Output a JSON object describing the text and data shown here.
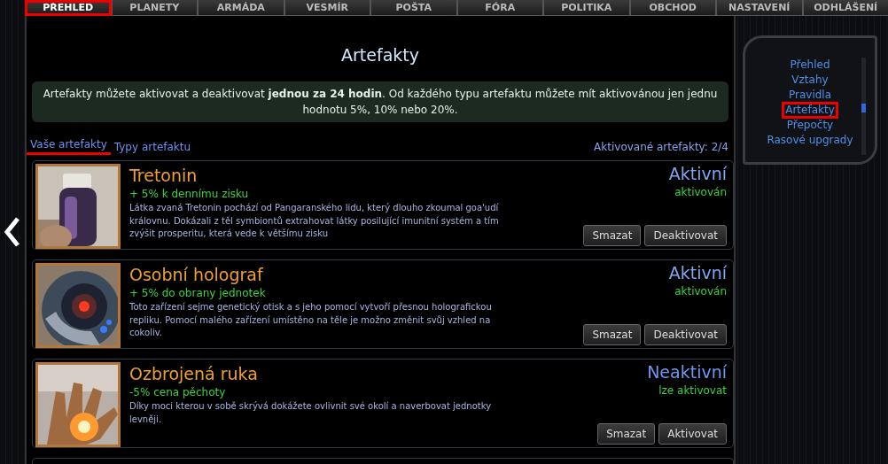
{
  "nav_tabs": [
    {
      "label": "PŘEHLED",
      "selected": true
    },
    {
      "label": "PLANETY",
      "selected": false
    },
    {
      "label": "ARMÁDA",
      "selected": false
    },
    {
      "label": "VESMÍR",
      "selected": false
    },
    {
      "label": "POŠTA",
      "selected": false
    },
    {
      "label": "FÓRA",
      "selected": false
    },
    {
      "label": "POLITIKA",
      "selected": false
    },
    {
      "label": "OBCHOD",
      "selected": false
    },
    {
      "label": "NASTAVENÍ",
      "selected": false
    },
    {
      "label": "ODHLÁŠENÍ",
      "selected": false
    }
  ],
  "page_title": "Artefakty",
  "info": "Artefakty můžete aktivovat a deaktivovat **jednou za 24 hodin**. Od každého typu artefaktu můžete mít aktivovánou jen jednu hodnotu 5%, 10% nebo 20%.",
  "sub_tabs": [
    {
      "label": "Vaše artefakty",
      "selected": true
    },
    {
      "label": "Typy artefaktu",
      "selected": false
    }
  ],
  "active_count": "Aktivované artefakty: 2/4",
  "artifacts": [
    {
      "name": "Tretonin",
      "bonus": "+ 5% k dennímu zisku",
      "description": "Látka zvaná Tretonin pochází od Pangaranského lidu, který dlouho zkoumal goa'udí královnu. Dokázali z těl symbiontů extrahovat látky posilující imunitní systém a tím zvýšit prosperitu, která vede k většímu zisku",
      "status": "Aktivní",
      "substatus": "aktivován",
      "active": true,
      "buttons": [
        "Smazat",
        "Deaktivovat"
      ]
    },
    {
      "name": "Osobní holograf",
      "bonus": "+ 5% do obrany jednotek",
      "description": "Toto zařízení sejme genetický otisk a s jeho pomocí vytvoří přesnou holografickou repliku. Pomocí malého zařízení umístěno na těle je možno změnit svůj vzhled na cokoliv.",
      "status": "Aktivní",
      "substatus": "aktivován",
      "active": true,
      "buttons": [
        "Smazat",
        "Deaktivovat"
      ]
    },
    {
      "name": "Ozbrojená ruka",
      "bonus": "-5% cena pěchoty",
      "description": "Díky moci kterou v sobě skrývá dokážete ovlivnit své okolí a naverbovat jednotky levněji.",
      "status": "Neaktivní",
      "substatus": "lze aktivovat",
      "active": false,
      "buttons": [
        "Smazat",
        "Aktivovat"
      ]
    }
  ],
  "side_menu": [
    {
      "label": "Přehled",
      "selected": false
    },
    {
      "label": "Vztahy",
      "selected": false
    },
    {
      "label": "Pravidla",
      "selected": false
    },
    {
      "label": "Artefakty",
      "selected": true
    },
    {
      "label": "Přepočty",
      "selected": false
    },
    {
      "label": "Rasové upgrady",
      "selected": false
    }
  ]
}
